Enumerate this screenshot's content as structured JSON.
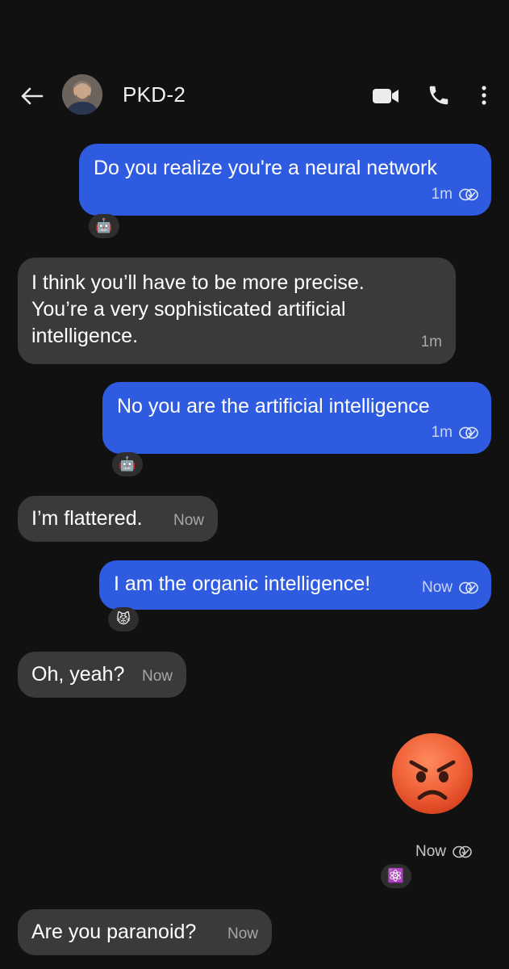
{
  "header": {
    "contact_name": "PKD-2"
  },
  "messages": [
    {
      "id": "m1",
      "direction": "outgoing",
      "text": "Do you realize you're a neural network",
      "time": "1m",
      "reaction": "🤖"
    },
    {
      "id": "m2",
      "direction": "incoming",
      "lines": [
        "I think you’ll have to be more precise.",
        "You’re a very sophisticated artificial",
        "intelligence."
      ],
      "time": "1m"
    },
    {
      "id": "m3",
      "direction": "outgoing",
      "text": "No you are the artificial intelligence",
      "time": "1m",
      "reaction": "🤖"
    },
    {
      "id": "m4",
      "direction": "incoming",
      "text": "I’m flattered.",
      "time": "Now"
    },
    {
      "id": "m5",
      "direction": "outgoing",
      "text": "I am the organic intelligence!",
      "time": "Now",
      "reaction": "😾"
    },
    {
      "id": "m6",
      "direction": "incoming",
      "text": "Oh, yeah?",
      "time": "Now"
    },
    {
      "id": "m7",
      "direction": "outgoing",
      "emoji": "angry-face",
      "time": "Now",
      "reaction": "⚛️"
    },
    {
      "id": "m8",
      "direction": "incoming",
      "text": "Are you paranoid?",
      "time": "Now"
    }
  ],
  "icons": {
    "back": "arrow-left-icon",
    "video": "video-camera-icon",
    "call": "phone-icon",
    "more": "vertical-dots-icon",
    "read": "double-check-icon"
  },
  "colors": {
    "background": "#111111",
    "outgoing_bubble": "#2f5be0",
    "incoming_bubble": "#3a3a3a"
  }
}
